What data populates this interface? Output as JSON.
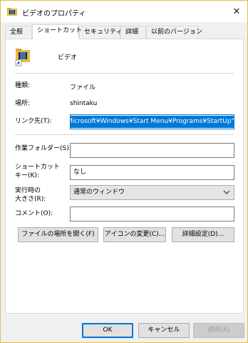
{
  "window": {
    "title": "ビデオのプロパティ",
    "close_glyph": "✕"
  },
  "tabs": [
    {
      "label": "全般"
    },
    {
      "label": "ショートカット",
      "active": true
    },
    {
      "label": "セキュリティ"
    },
    {
      "label": "詳細"
    },
    {
      "label": "以前のバージョン"
    }
  ],
  "shortcut": {
    "name": "ビデオ",
    "type_label": "種類:",
    "type_value": "ファイル",
    "location_label": "場所:",
    "location_value": "shintaku",
    "target_label": "リンク先(T):",
    "target_value": "Microsoft¥Windows¥Start Menu¥Programs¥StartUp\"",
    "startin_label": "作業フォルダー(S):",
    "startin_value": "",
    "hotkey_label_1": "ショートカット",
    "hotkey_label_2": "キー(K):",
    "hotkey_value": "なし",
    "run_label_1": "実行時の",
    "run_label_2": "大きさ(R):",
    "run_value": "通常のウィンドウ",
    "comment_label": "コメント(O):",
    "comment_value": "",
    "open_location_button": "ファイルの場所を開く(F)",
    "change_icon_button": "アイコンの変更(C)...",
    "advanced_button": "詳細設定(D)..."
  },
  "footer": {
    "ok_button": "OK",
    "cancel_button": "キャンセル",
    "apply_button": "適用(A)"
  },
  "colors": {
    "accent": "#0078d7",
    "window_border": "#e2bd4c"
  }
}
